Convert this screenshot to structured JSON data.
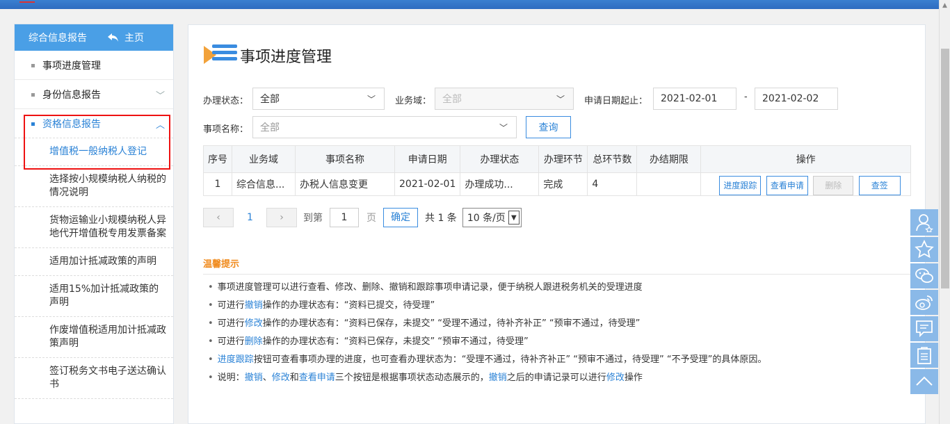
{
  "sidebar": {
    "header_title": "综合信息报告",
    "home_label": "主页",
    "items": [
      {
        "label": "事项进度管理"
      },
      {
        "label": "身份信息报告"
      },
      {
        "label": "资格信息报告"
      }
    ],
    "subitems": [
      {
        "label": "增值税一般纳税人登记"
      },
      {
        "label": "选择按小规模纳税人纳税的情况说明"
      },
      {
        "label": "货物运输业小规模纳税人异地代开增值税专用发票备案"
      },
      {
        "label": "适用加计抵减政策的声明"
      },
      {
        "label": "适用15%加计抵减政策的声明"
      },
      {
        "label": "作废增值税适用加计抵减政策声明"
      },
      {
        "label": "签订税务文书电子送达确认书"
      }
    ]
  },
  "page": {
    "title": "事项进度管理"
  },
  "filters": {
    "status_label": "办理状态：",
    "status_value": "全部",
    "domain_label": "业务域：",
    "domain_value": "全部",
    "date_label": "申请日期起止：",
    "date_from": "2021-02-01",
    "date_sep": "-",
    "date_to": "2021-02-02",
    "item_label": "事项名称：",
    "item_value": "全部",
    "query_button": "查询"
  },
  "table": {
    "headers": [
      "序号",
      "业务域",
      "事项名称",
      "申请日期",
      "办理状态",
      "办理环节",
      "总环节数",
      "办结期限",
      "操作"
    ],
    "rows": [
      {
        "index": "1",
        "domain": "综合信息...",
        "name": "办税人信息变更",
        "date": "2021-02-01",
        "status": "办理成功...",
        "stage": "完成",
        "total_stages": "4",
        "deadline": ""
      }
    ],
    "actions": [
      "进度跟踪",
      "查看申请",
      "删除",
      "查签"
    ]
  },
  "pager": {
    "prev": "‹",
    "current": "1",
    "next": "›",
    "goto_label": "到第",
    "goto_value": "1",
    "page_unit": "页",
    "confirm": "确定",
    "total": "共 1 条",
    "page_size": "10 条/页"
  },
  "tips": {
    "title": "温馨提示",
    "l1": "事项进度管理可以进行查看、修改、删除、撤销和跟踪事项申请记录，便于纳税人跟进税务机关的受理进度",
    "l2a": "可进行",
    "l2b": "撤销",
    "l2c": "操作的办理状态有：“资料已提交，待受理”",
    "l3a": "可进行",
    "l3b": "修改",
    "l3c": "操作的办理状态有：“资料已保存，未提交” “受理不通过，待补齐补正” “预审不通过，待受理”",
    "l4a": "可进行",
    "l4b": "删除",
    "l4c": "操作的办理状态有：“资料已保存，未提交” “预审不通过，待受理”",
    "l5a": "进度跟踪",
    "l5b": "按钮可查看事项办理的进度，也可查看办理状态为：“受理不通过，待补齐补正” “预审不通过，待受理” “不予受理”的具体原因。",
    "l6a": "说明：",
    "l6b": "撤销",
    "l6c": "、",
    "l6d": "修改",
    "l6e": "和",
    "l6f": "查看申请",
    "l6g": "三个按钮是根据事项状态动态展示的，",
    "l6h": "撤销",
    "l6i": "之后的申请记录可以进行",
    "l6j": "修改",
    "l6k": "操作"
  },
  "floatbar": [
    "user-icon",
    "star-icon",
    "wechat-icon",
    "weibo-icon",
    "message-icon",
    "clipboard-icon",
    "arrow-up-icon"
  ]
}
